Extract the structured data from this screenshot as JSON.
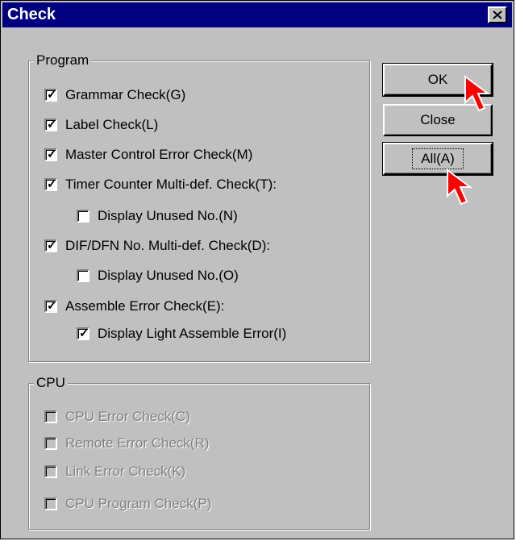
{
  "window": {
    "title": "Check"
  },
  "program_group": {
    "label": "Program",
    "items": [
      {
        "label": "Grammar Check(G)",
        "checked": true
      },
      {
        "label": "Label Check(L)",
        "checked": true
      },
      {
        "label": "Master Control Error Check(M)",
        "checked": true
      },
      {
        "label": "Timer Counter Multi-def. Check(T):",
        "checked": true
      },
      {
        "label": "Display Unused No.(N)",
        "checked": false
      },
      {
        "label": "DIF/DFN No. Multi-def. Check(D):",
        "checked": true
      },
      {
        "label": "Display Unused No.(O)",
        "checked": false
      },
      {
        "label": "Assemble Error Check(E):",
        "checked": true
      },
      {
        "label": "Display Light Assemble Error(I)",
        "checked": true
      }
    ]
  },
  "cpu_group": {
    "label": "CPU",
    "items": [
      {
        "label": "CPU Error Check(C)",
        "checked": false,
        "disabled": true
      },
      {
        "label": "Remote Error Check(R)",
        "checked": false,
        "disabled": true
      },
      {
        "label": "Link Error Check(K)",
        "checked": false,
        "disabled": true
      },
      {
        "label": "CPU Program Check(P)",
        "checked": false,
        "disabled": true
      }
    ]
  },
  "buttons": {
    "ok": "OK",
    "close": "Close",
    "all": "All(A)"
  },
  "colors": {
    "titlebar": "#000080",
    "face": "#c0c0c0",
    "cursor": "#ff0000"
  },
  "icons": {
    "window_close": "close-icon",
    "checkmark": "checkmark-icon",
    "pointer": "red-arrow-cursor"
  }
}
